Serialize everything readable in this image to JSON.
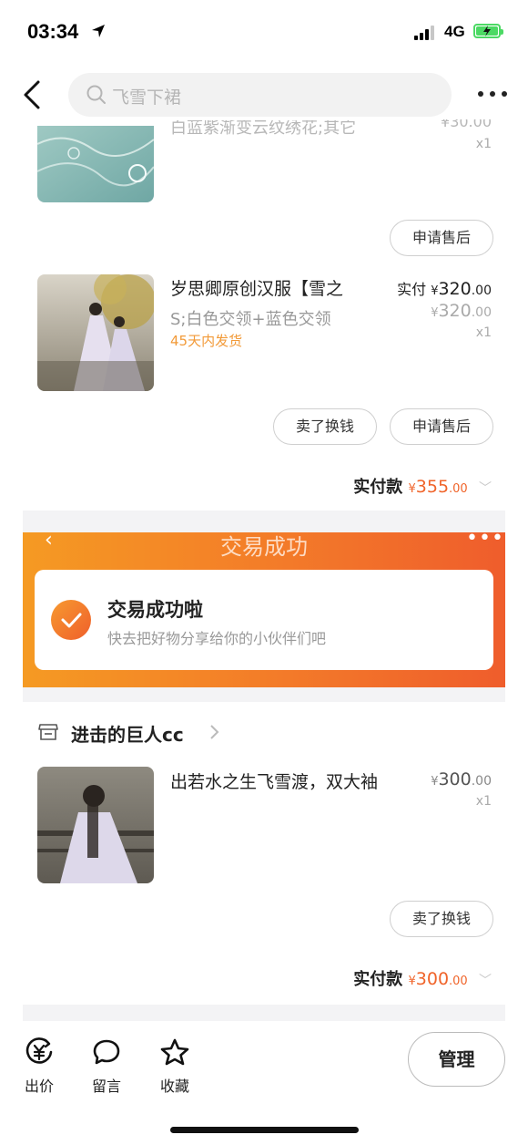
{
  "status_bar": {
    "time": "03:34",
    "network": "4G"
  },
  "nav": {
    "search_placeholder": "飞雪下裙"
  },
  "orders": [
    {
      "item_top": {
        "spec_partial": "白蓝紫渐变云纹绣花;其它",
        "price_partial": "¥30.00",
        "qty": "x1"
      },
      "after_sale_button": "申请售后",
      "item": {
        "title": "岁思卿原创汉服【雪之",
        "spec": "S;白色交领+蓝色交领",
        "shipping": "45天内发货",
        "paid_label": "实付",
        "paid_yen": "¥",
        "paid_int": "320",
        "paid_dec": ".00",
        "orig_yen": "¥",
        "orig_int": "320",
        "orig_dec": ".00",
        "qty": "x1"
      },
      "resell_button": "卖了换钱",
      "after_sale_button_2": "申请售后",
      "total": {
        "label": "实付款",
        "yen": "¥",
        "int": "355",
        "dec": ".00"
      }
    },
    {
      "shop_name": "进击的巨人cc",
      "item": {
        "title": "出若水之生飞雪渡，双大袖",
        "yen": "¥",
        "int": "300",
        "dec": ".00",
        "qty": "x1"
      },
      "resell_button": "卖了换钱",
      "total": {
        "label": "实付款",
        "yen": "¥",
        "int": "300",
        "dec": ".00"
      }
    }
  ],
  "success_banner": {
    "header_title": "交易成功",
    "card_title": "交易成功啦",
    "card_subtitle": "快去把好物分享给你的小伙伴们吧"
  },
  "bottom_bar": {
    "offer": "出价",
    "message": "留言",
    "favorite": "收藏",
    "manage": "管理"
  }
}
